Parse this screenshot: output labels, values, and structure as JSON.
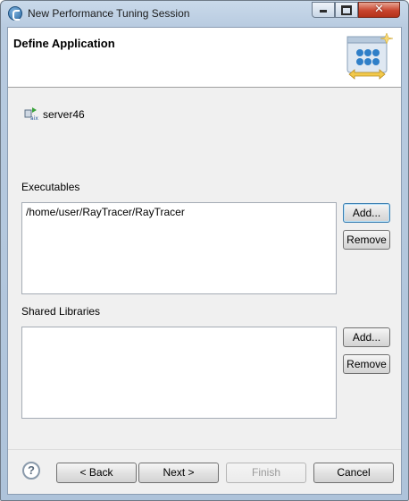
{
  "window": {
    "title": "New Performance Tuning Session",
    "controls": {
      "minimize": "minimize-icon",
      "maximize": "maximize-icon",
      "close": "close-icon"
    }
  },
  "header": {
    "title": "Define Application",
    "image": "wizard-banner-icon"
  },
  "server": {
    "icon": "aix-server-icon",
    "name": "server46"
  },
  "executables": {
    "label": "Executables",
    "items": [
      "/home/user/RayTracer/RayTracer"
    ],
    "add_label": "Add...",
    "remove_label": "Remove"
  },
  "shared_libraries": {
    "label": "Shared Libraries",
    "items": [],
    "add_label": "Add...",
    "remove_label": "Remove"
  },
  "footer": {
    "help_icon": "help-icon",
    "back_label": "< Back",
    "next_label": "Next >",
    "finish_label": "Finish",
    "cancel_label": "Cancel"
  },
  "colors": {
    "frame": "#b8cbe0",
    "close_button": "#c8432d",
    "focus_border": "#3c7fb1",
    "dialog_background": "#f0f0f0"
  }
}
